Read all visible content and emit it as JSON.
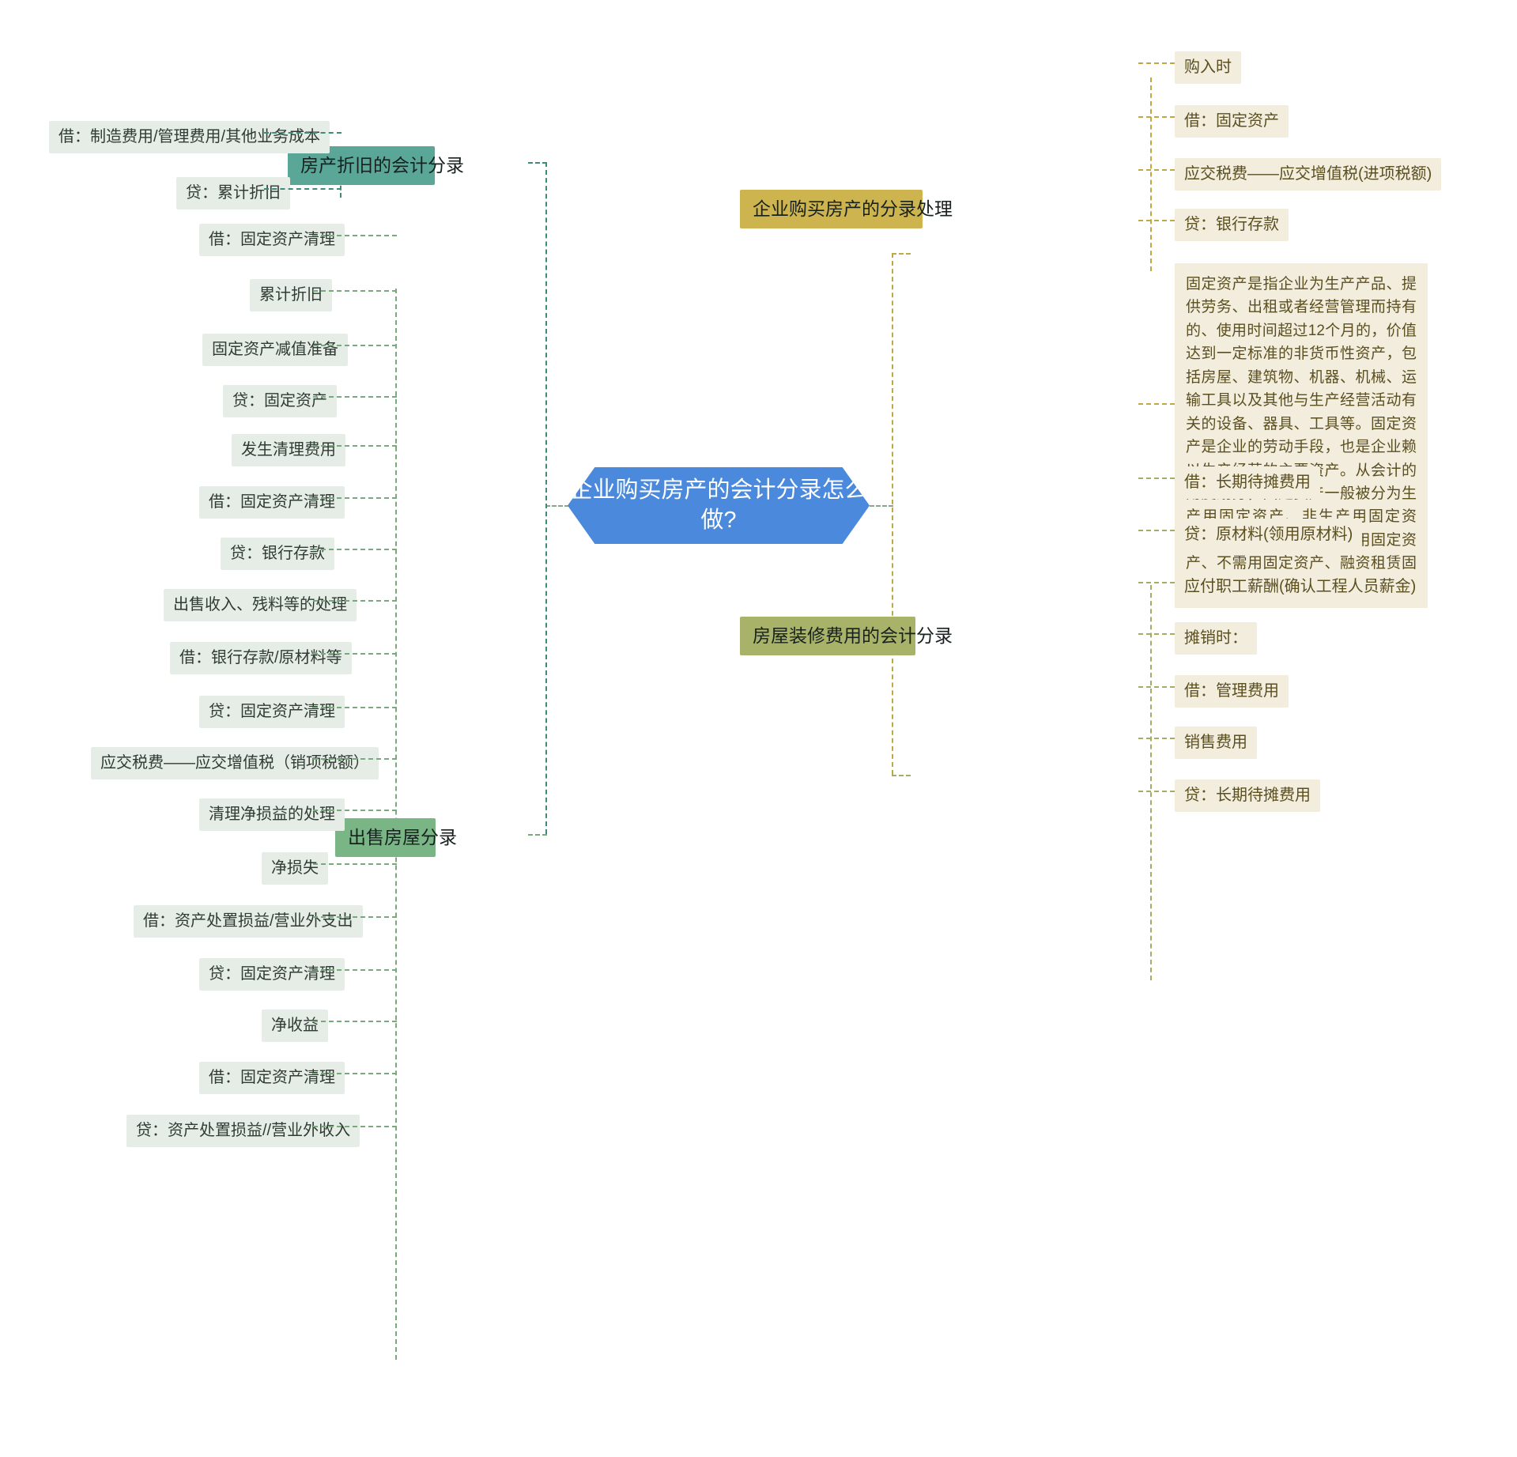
{
  "central": {
    "text": "企业购买房产的会计分录怎么做?",
    "color": "#4a89dc"
  },
  "branches": [
    {
      "id": "fangchan-zhejiu",
      "label": "房产折旧的会计分录",
      "color": "#5aa798",
      "side": "left",
      "children": [
        {
          "label": "借：制造费用/管理费用/其他业务成本"
        },
        {
          "label": "贷：累计折旧"
        }
      ]
    },
    {
      "id": "chushou-fangwu",
      "label": "出售房屋分录",
      "color": "#7ab585",
      "side": "left",
      "children": [
        {
          "label": "借：固定资产清理"
        },
        {
          "label": "累计折旧"
        },
        {
          "label": "固定资产减值准备"
        },
        {
          "label": "贷：固定资产"
        },
        {
          "label": "发生清理费用"
        },
        {
          "label": "借：固定资产清理"
        },
        {
          "label": "贷：银行存款"
        },
        {
          "label": "出售收入、残料等的处理"
        },
        {
          "label": "借：银行存款/原材料等"
        },
        {
          "label": "贷：固定资产清理"
        },
        {
          "label": "应交税费——应交增值税（销项税额）"
        },
        {
          "label": "清理净损益的处理"
        },
        {
          "label": "净损失"
        },
        {
          "label": "借：资产处置损益/营业外支出"
        },
        {
          "label": "贷：固定资产清理"
        },
        {
          "label": "净收益"
        },
        {
          "label": "借：固定资产清理"
        },
        {
          "label": "贷：资产处置损益//营业外收入"
        }
      ]
    },
    {
      "id": "qiye-goumai",
      "label": "企业购买房产的分录处理",
      "color": "#cdb44f",
      "side": "right",
      "children": [
        {
          "label": "购入时"
        },
        {
          "label": "借：固定资产"
        },
        {
          "label": "应交税费——应交增值税(进项税额)"
        },
        {
          "label": "贷：银行存款"
        }
      ]
    },
    {
      "id": "fangwu-zhuangxiu",
      "label": "房屋装修费用的会计分录",
      "color": "#a8b268",
      "side": "right",
      "children": [
        {
          "label": "借：长期待摊费用"
        },
        {
          "label": "贷：原材料(领用原材料)"
        },
        {
          "label": "应付职工薪酬(确认工程人员薪金)"
        },
        {
          "label": "摊销时："
        },
        {
          "label": "借：管理费用"
        },
        {
          "label": "销售费用"
        },
        {
          "label": "贷：长期待摊费用"
        }
      ]
    }
  ],
  "note": {
    "text": "固定资产是指企业为生产产品、提供劳务、出租或者经营管理而持有的、使用时间超过12个月的，价值达到一定标准的非货币性资产，包括房屋、建筑物、机器、机械、运输工具以及其他与生产经营活动有关的设备、器具、工具等。固定资产是企业的劳动手段，也是企业赖以生产经营的主要资产。从会计的角度划分，固定资产一般被分为生产用固定资产、非生产用固定资产、租出固定资产、未使用固定资产、不需用固定资产、融资租赁固定资产、接受捐赠固定资产等。",
    "background": "#f2eddd",
    "color": "#5b4f20"
  }
}
